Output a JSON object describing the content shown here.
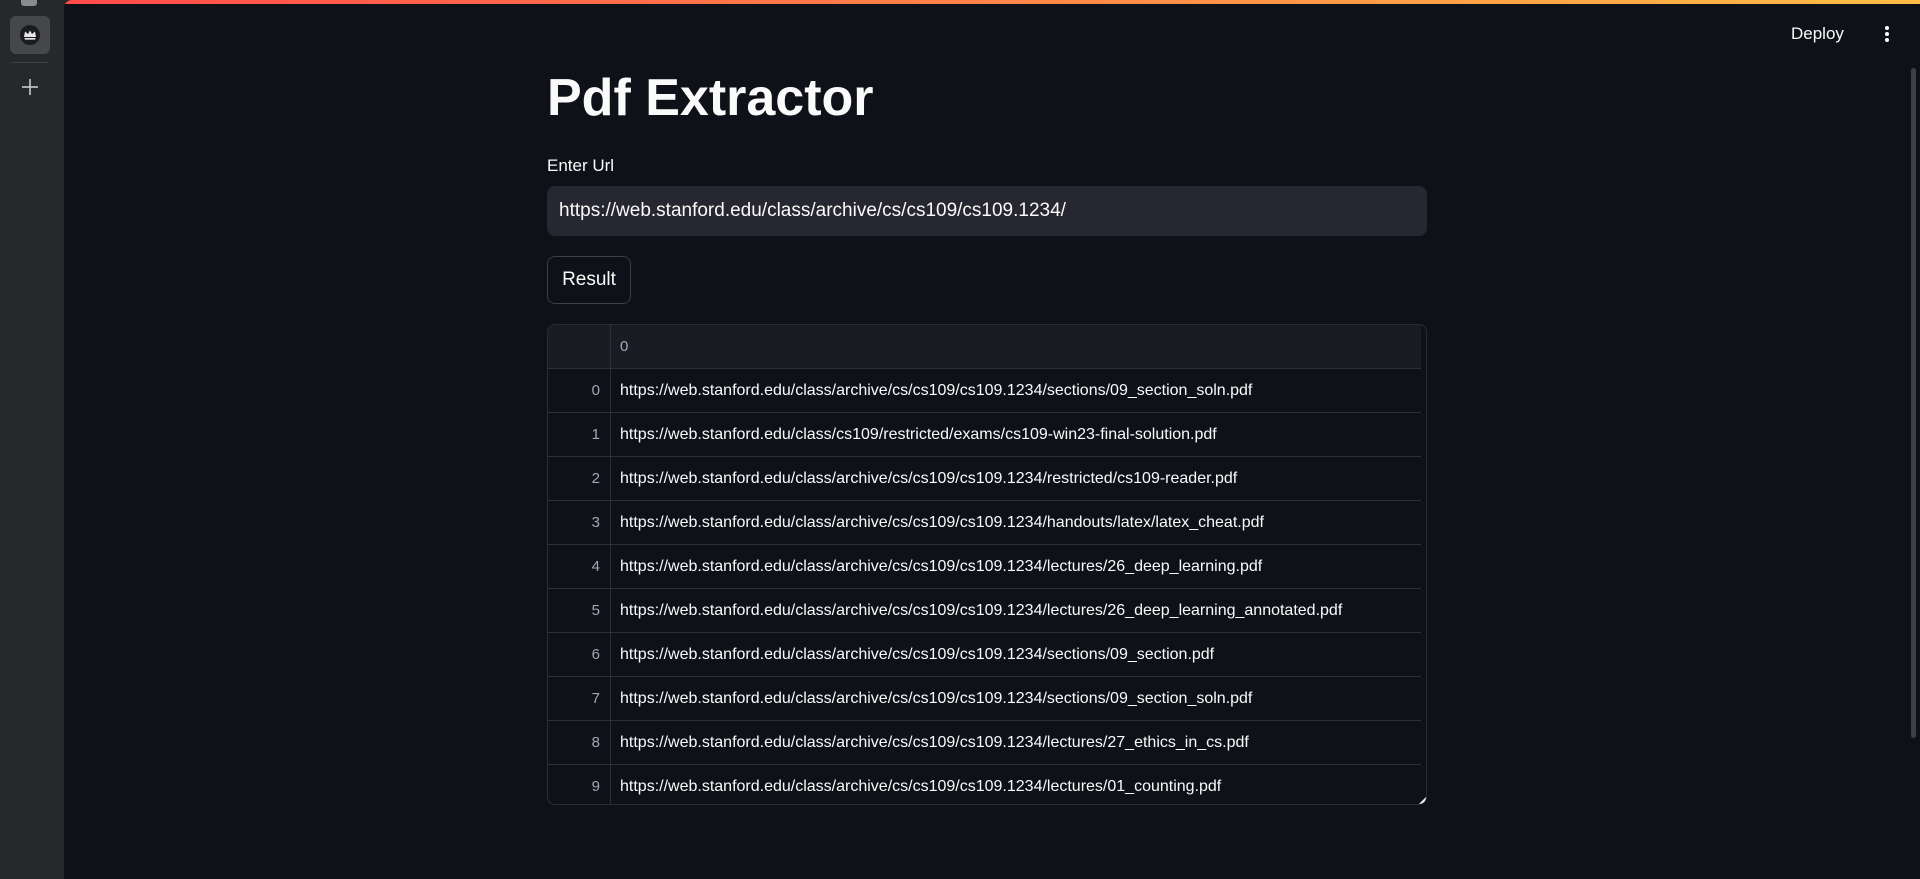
{
  "header": {
    "deploy_label": "Deploy",
    "menu_icon": "more-vertical-icon"
  },
  "sidebar": {
    "active_tab_icon": "crown-icon",
    "add_icon": "plus-icon"
  },
  "colors": {
    "background": "#0e1117",
    "input_background": "#262730",
    "text": "#fafafa",
    "accent_gradient_start": "#ff4b4b",
    "accent_gradient_end": "#ffbd45"
  },
  "main": {
    "title": "Pdf Extractor",
    "input_label": "Enter Url",
    "input_value": "https://web.stanford.edu/class/archive/cs/cs109/cs109.1234/",
    "button_label": "Result"
  },
  "table": {
    "column_header": "0",
    "rows": [
      {
        "index": "0",
        "value": "https://web.stanford.edu/class/archive/cs/cs109/cs109.1234/sections/09_section_soln.pdf"
      },
      {
        "index": "1",
        "value": "https://web.stanford.edu/class/cs109/restricted/exams/cs109-win23-final-solution.pdf"
      },
      {
        "index": "2",
        "value": "https://web.stanford.edu/class/archive/cs/cs109/cs109.1234/restricted/cs109-reader.pdf"
      },
      {
        "index": "3",
        "value": "https://web.stanford.edu/class/archive/cs/cs109/cs109.1234/handouts/latex/latex_cheat.pdf"
      },
      {
        "index": "4",
        "value": "https://web.stanford.edu/class/archive/cs/cs109/cs109.1234/lectures/26_deep_learning.pdf"
      },
      {
        "index": "5",
        "value": "https://web.stanford.edu/class/archive/cs/cs109/cs109.1234/lectures/26_deep_learning_annotated.pdf"
      },
      {
        "index": "6",
        "value": "https://web.stanford.edu/class/archive/cs/cs109/cs109.1234/sections/09_section.pdf"
      },
      {
        "index": "7",
        "value": "https://web.stanford.edu/class/archive/cs/cs109/cs109.1234/sections/09_section_soln.pdf"
      },
      {
        "index": "8",
        "value": "https://web.stanford.edu/class/archive/cs/cs109/cs109.1234/lectures/27_ethics_in_cs.pdf"
      },
      {
        "index": "9",
        "value": "https://web.stanford.edu/class/archive/cs/cs109/cs109.1234/lectures/01_counting.pdf"
      }
    ]
  }
}
